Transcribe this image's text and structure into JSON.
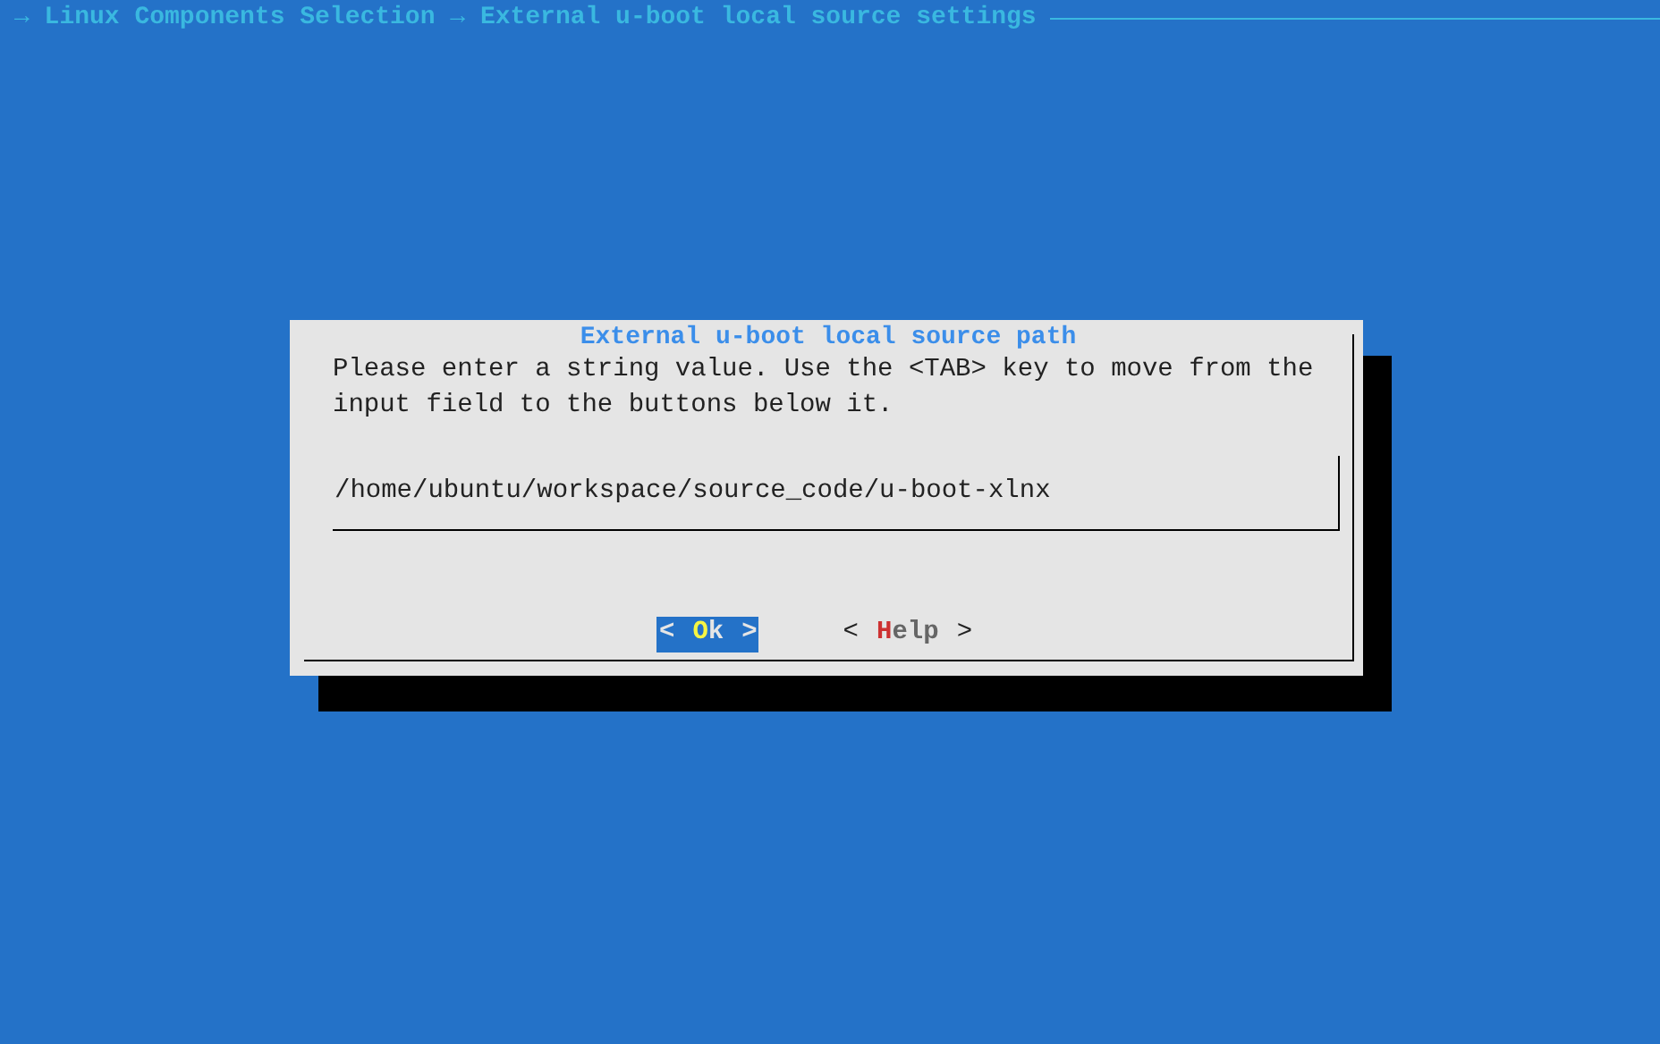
{
  "breadcrumb": "→ Linux Components Selection → External u-boot local source settings",
  "dialog": {
    "title": "External u-boot local source path",
    "message": "Please enter a string value. Use the <TAB> key to move from the input field to the buttons below it.",
    "input": {
      "value": "/home/ubuntu/workspace/source_code/u-boot-xlnx"
    },
    "buttons": [
      {
        "left": "<",
        "hotkey": "O",
        "rest": "k",
        "right": ">",
        "selected": true
      },
      {
        "left": "<",
        "hotkey": "H",
        "rest": "elp",
        "right": ">",
        "selected": false
      }
    ]
  }
}
